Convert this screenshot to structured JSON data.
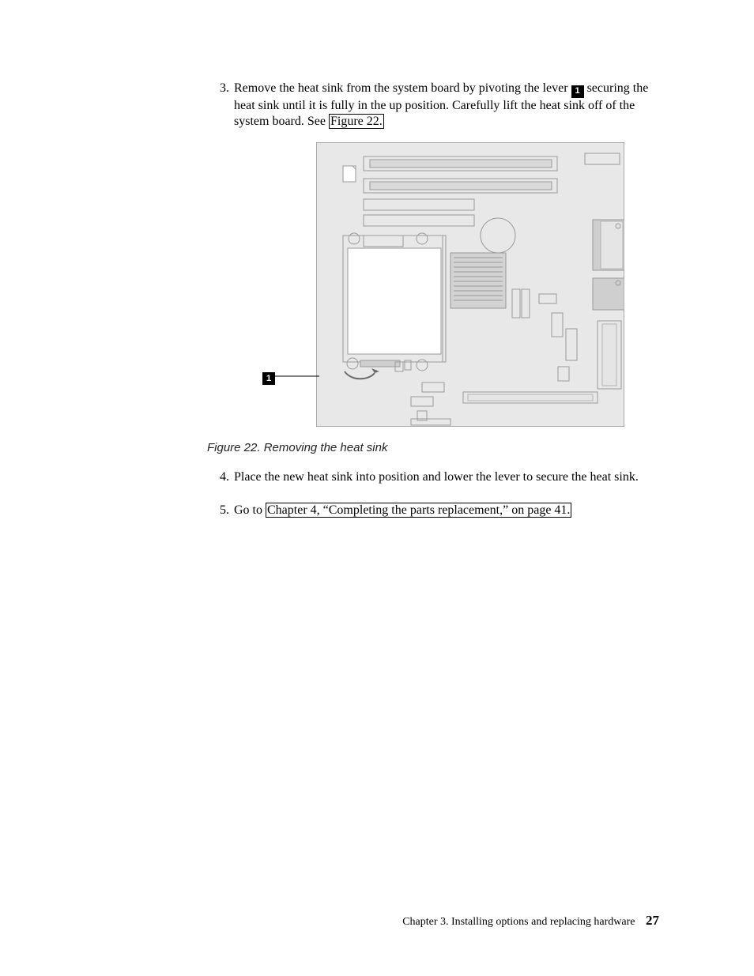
{
  "steps": {
    "s3": {
      "num": "3.",
      "text_before": "Remove the heat sink from the system board by pivoting the lever ",
      "callout": "1",
      "text_after": " securing the heat sink until it is fully in the up position. Carefully lift the heat sink off of the system board. See ",
      "link": "Figure 22.",
      "text_end": ""
    },
    "s4": {
      "num": "4.",
      "text": "Place the new heat sink into position and lower the lever to secure the heat sink."
    },
    "s5": {
      "num": "5.",
      "text_before": "Go to ",
      "link": "Chapter 4, “Completing the parts replacement,” on page 41.",
      "text_after": ""
    }
  },
  "figure": {
    "caption_label": "Figure 22.",
    "caption_text": "Removing the heat sink",
    "callout": "1"
  },
  "footer": {
    "chapter": "Chapter 3. Installing options and replacing hardware",
    "page": "27"
  }
}
